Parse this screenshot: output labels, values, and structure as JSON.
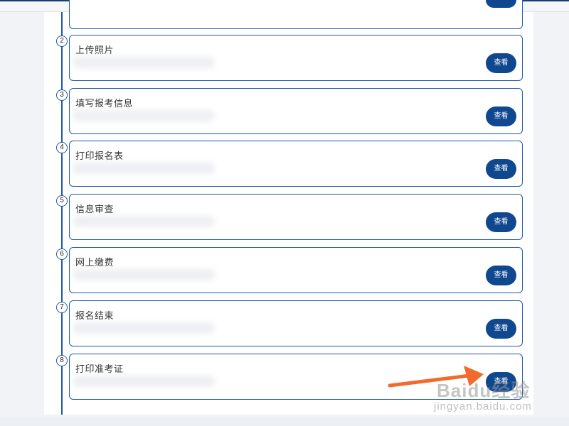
{
  "steps": [
    {
      "number": "2",
      "title": "上传照片",
      "button": "查看"
    },
    {
      "number": "3",
      "title": "填写报考信息",
      "button": "查看"
    },
    {
      "number": "4",
      "title": "打印报名表",
      "button": "查看"
    },
    {
      "number": "5",
      "title": "信息审查",
      "button": "查看"
    },
    {
      "number": "6",
      "title": "网上缴费",
      "button": "查看"
    },
    {
      "number": "7",
      "title": "报名结束",
      "button": "查看"
    },
    {
      "number": "8",
      "title": "打印准考证",
      "button": "查看"
    }
  ],
  "watermark": {
    "logo": "Baidu经验",
    "url": "jingyan.baidu.com"
  },
  "colors": {
    "accent": "#10488f",
    "timeline": "#1f5aa8",
    "arrow": "#f26a2d"
  }
}
